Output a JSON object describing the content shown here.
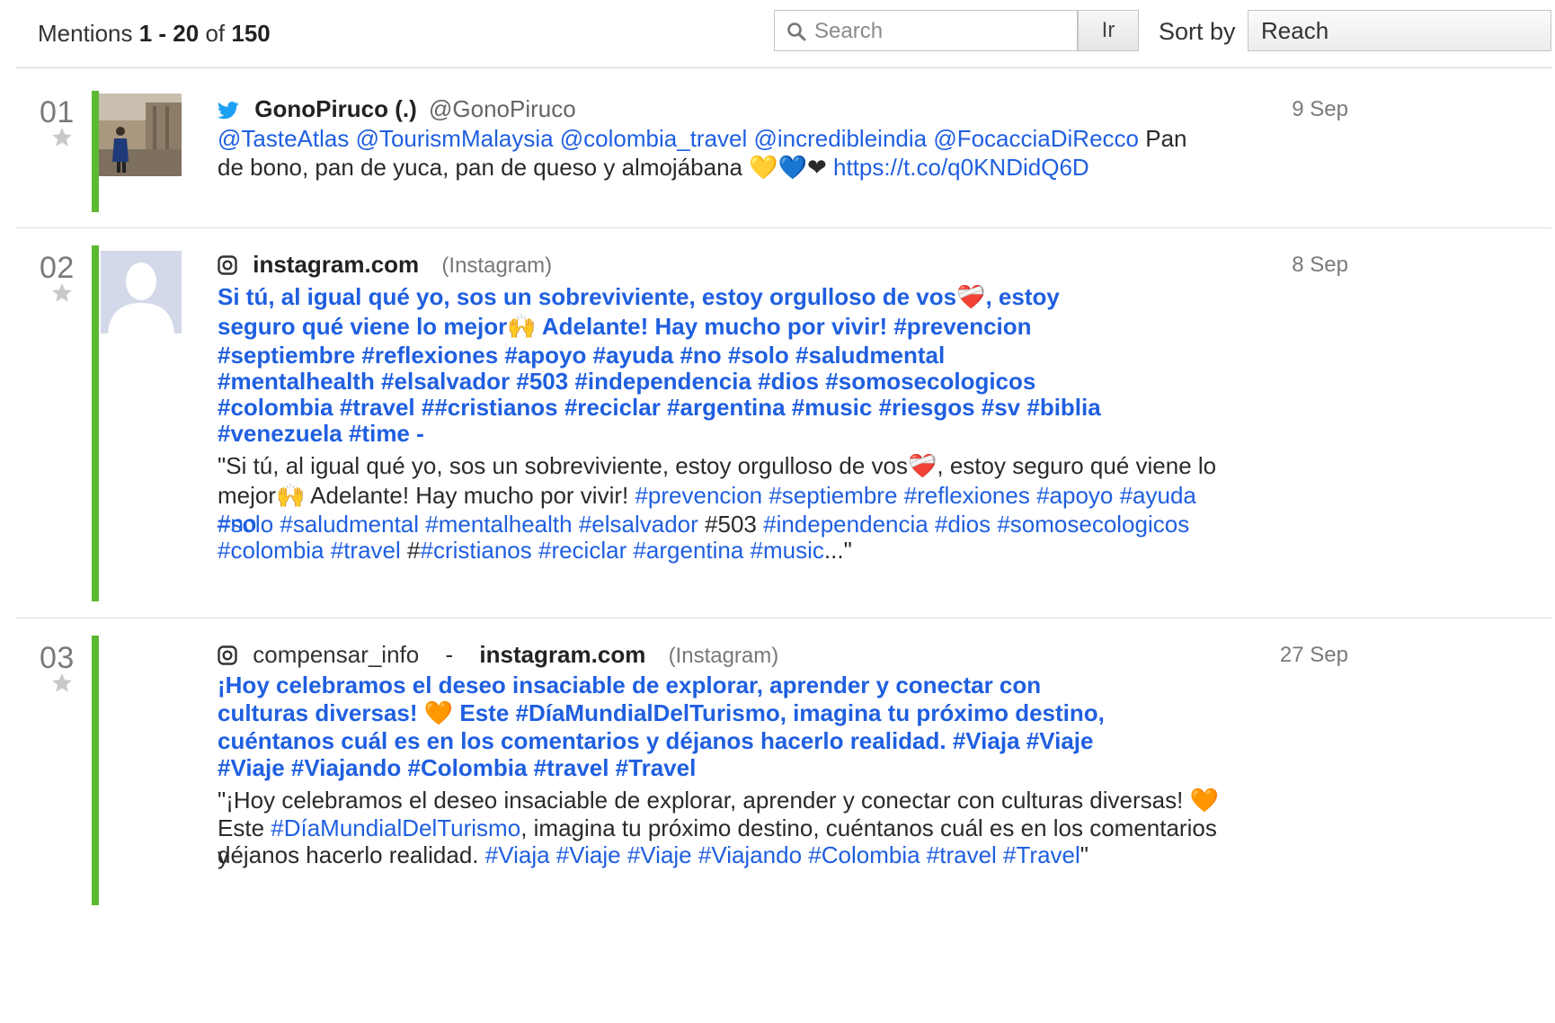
{
  "header": {
    "mentions_label": "Mentions",
    "range": "1 - 20",
    "of_label": "of",
    "total": "150",
    "search_placeholder": "Search",
    "go_label": "Ir",
    "sort_label": "Sort by",
    "sort_value": "Reach"
  },
  "mentions": [
    {
      "rank": "01",
      "source_icon": "twitter-bird-icon",
      "author": "GonoPiruco (.)",
      "handle": "@GonoPiruco",
      "date": "9 Sep",
      "body": {
        "mentions": "@TasteAtlas @TourismMalaysia @colombia_travel @incredibleindia @FocacciaDiRecco",
        "text": "Pan de bono, pan de yuca, pan de queso y almojábana 💛💙❤",
        "link": "https://t.co/q0KNDidQ6D"
      }
    },
    {
      "rank": "02",
      "source_icon": "instagram-icon",
      "domain": "instagram.com",
      "network": "(Instagram)",
      "date": "8 Sep",
      "title_lines": [
        "Si tú, al igual qué yo, sos un sobreviviente, estoy orgulloso de vos❤️‍🩹, estoy",
        "seguro qué viene lo mejor🙌 Adelante! Hay mucho por vivir! #prevencion",
        "#septiembre #reflexiones #apoyo #ayuda #no #solo #saludmental",
        "#mentalhealth #elsalvador #503 #independencia #dios #somosecologicos",
        "#colombia #travel ##cristianos #reciclar #argentina #music #riesgos #sv #biblia",
        "#venezuela #time -"
      ],
      "snippet": {
        "l1": "\"Si tú, al igual qué yo, sos un sobreviviente, estoy orgulloso de vos❤️‍🩹, estoy seguro qué viene lo",
        "l2_text": "mejor🙌 Adelante! Hay mucho por vivir!",
        "l2_tags": "#prevencion #septiembre #reflexiones #apoyo #ayuda #no",
        "l3_tags_a": "#solo #saludmental #mentalhealth #elsalvador",
        "l3_plain": "#503",
        "l3_tags_b": "#independencia #dios #somosecologicos",
        "l4_tags_a": "#colombia #travel",
        "l4_plain": "#",
        "l4_tags_b": "#cristianos #reciclar #argentina #music",
        "l4_end": "...\""
      }
    },
    {
      "rank": "03",
      "source_icon": "instagram-icon",
      "user": "compensar_info",
      "dash": "-",
      "domain": "instagram.com",
      "network": "(Instagram)",
      "date": "27 Sep",
      "title_lines": [
        "¡Hoy celebramos el deseo insaciable de explorar, aprender y conectar con",
        "culturas diversas! 🧡 Este #DíaMundialDelTurismo, imagina tu próximo destino,",
        "cuéntanos cuál es en los comentarios y déjanos hacerlo realidad. #Viaja #Viaje",
        "#Viaje #Viajando #Colombia #travel #Travel"
      ],
      "snippet": {
        "l1": "\"¡Hoy celebramos el deseo insaciable de explorar, aprender y conectar con culturas diversas! 🧡",
        "l2_pre": "Este",
        "l2_tag": "#DíaMundialDelTurismo",
        "l2_post": ", imagina tu próximo destino, cuéntanos cuál es en los comentarios y",
        "l3_pre": "déjanos hacerlo realidad.",
        "l3_tags": "#Viaja #Viaje #Viaje #Viajando #Colombia #travel #Travel",
        "l3_end": "\""
      }
    }
  ],
  "colors": {
    "accent_bar": "#5cb932",
    "link": "#1f5fe0"
  }
}
